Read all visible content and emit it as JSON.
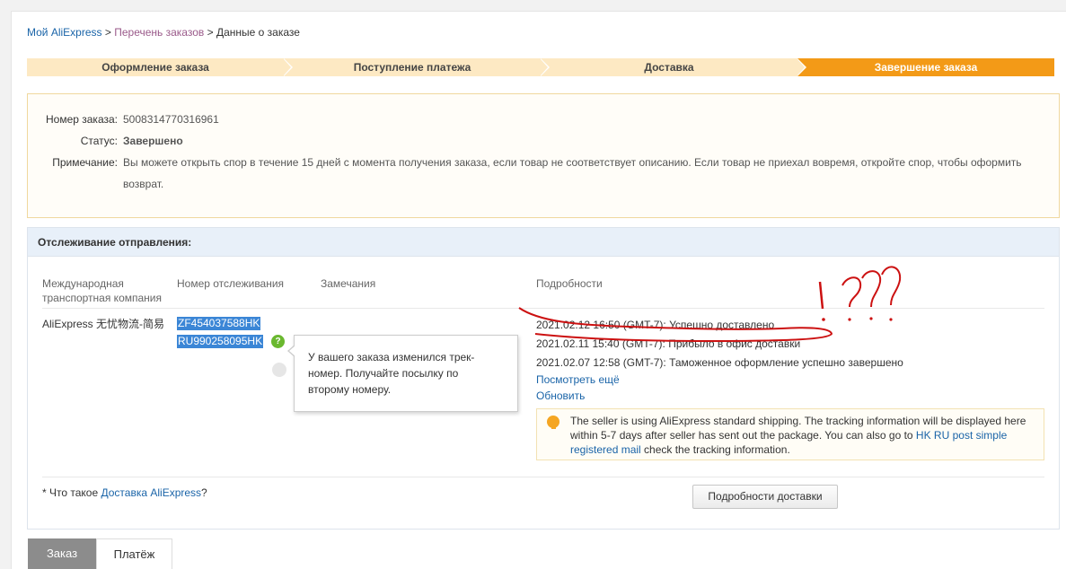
{
  "breadcrumb": {
    "home": "Мой AliExpress",
    "sep1": ">",
    "orders": "Перечень заказов",
    "sep2": ">",
    "current": "Данные о заказе"
  },
  "steps": [
    {
      "label": "Оформление заказа",
      "active": false
    },
    {
      "label": "Поступление платежа",
      "active": false
    },
    {
      "label": "Доставка",
      "active": false
    },
    {
      "label": "Завершение заказа",
      "active": true
    }
  ],
  "order": {
    "number_label": "Номер заказа:",
    "number_value": "5008314770316961",
    "status_label": "Статус:",
    "status_value": "Завершено",
    "note_label": "Примечание:",
    "note_line1": "Вы можете открыть спор в течение 15 дней с момента получения заказа, если товар не соответствует описанию. Если товар не приехал вовремя, откройте спор, чтобы оформить",
    "note_line2": "возврат."
  },
  "tracking": {
    "title": "Отслеживание отправления:",
    "columns": {
      "carrier_line1": "Международная",
      "carrier_line2": "транспортная компания",
      "number": "Номер отслеживания",
      "remarks": "Замечания",
      "details": "Подробности"
    },
    "carrier": "AliExpress 无忧物流-简易",
    "numbers": [
      "ZF454037588HK",
      "RU990258095HK"
    ],
    "help_glyph": "?",
    "tooltip_lines": [
      "У вашего заказа изменился трек-",
      "номер. Получайте посылку по",
      "второму номеру."
    ],
    "events": [
      "2021.02.12 16:50 (GMT-7): Успешно доставлено",
      "2021.02.11 15:40 (GMT-7): Прибыло в офис доставки",
      "2021.02.07 12:58 (GMT-7): Таможенное оформление успешно завершено"
    ],
    "more_link": "Посмотреть ещё",
    "refresh_link": "Обновить",
    "notice": {
      "text1": "The seller is using AliExpress standard shipping. The tracking information will be displayed here within 5-7 days after seller has sent out the package. You can also go to ",
      "link": "HK RU post simple registered mail",
      "text2": " check the tracking information."
    },
    "footnote_prefix": "* Что такое ",
    "footnote_link": "Доставка AliExpress",
    "footnote_suffix": "?",
    "details_button": "Подробности доставки"
  },
  "annotation": {
    "text": "!???",
    "color": "#cc1111"
  },
  "tabs": [
    {
      "label": "Заказ",
      "active": true
    },
    {
      "label": "Платёж",
      "active": false
    }
  ]
}
